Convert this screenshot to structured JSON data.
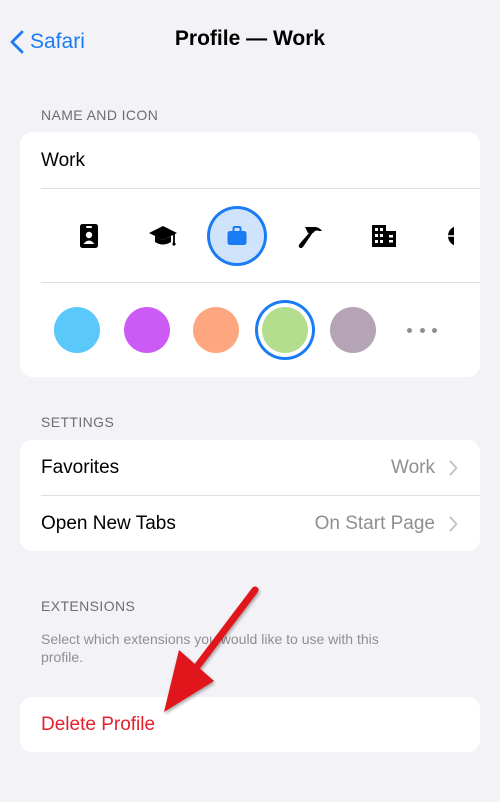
{
  "nav": {
    "back_label": "Safari",
    "title": "Profile — Work"
  },
  "name_and_icon": {
    "header": "NAME AND ICON",
    "profile_name": "Work",
    "icons": [
      "id-badge-icon",
      "graduation-cap-icon",
      "briefcase-icon",
      "hammer-icon",
      "building-icon",
      "globe-icon"
    ],
    "selected_icon": "briefcase-icon",
    "colors": [
      "#5ac8fa",
      "#cc5bf5",
      "#fda67f",
      "#b2de8d",
      "#b5a3b6"
    ],
    "selected_color": "#b2de8d"
  },
  "settings": {
    "header": "SETTINGS",
    "rows": [
      {
        "label": "Favorites",
        "value": "Work"
      },
      {
        "label": "Open New Tabs",
        "value": "On Start Page"
      }
    ]
  },
  "extensions": {
    "header": "EXTENSIONS",
    "footnote": "Select which extensions you would like to use with this profile."
  },
  "delete": {
    "label": "Delete Profile"
  },
  "colors": {
    "accent": "#1a7cf5",
    "destructive": "#e5202c",
    "annotation_arrow": "#e0141f"
  }
}
